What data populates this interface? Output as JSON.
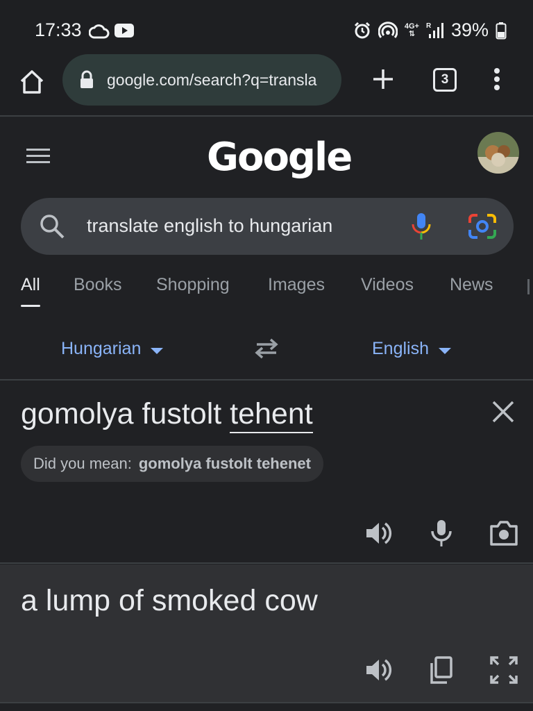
{
  "status_bar": {
    "time": "17:33",
    "network_top": "4G+",
    "network_roaming": "R",
    "battery_percent": "39%"
  },
  "browser": {
    "url": "google.com/search?q=transla",
    "tab_count": "3"
  },
  "google": {
    "logo_text": "Google"
  },
  "search": {
    "query": "translate english to hungarian"
  },
  "tabs": [
    {
      "label": "All",
      "active": true
    },
    {
      "label": "Books"
    },
    {
      "label": "Shopping"
    },
    {
      "label": "Images"
    },
    {
      "label": "Videos"
    },
    {
      "label": "News"
    }
  ],
  "translator": {
    "source_language": "Hungarian",
    "target_language": "English",
    "source_text_part1": "gomolya fustolt ",
    "source_text_part2": "tehent",
    "did_you_mean_label": "Did you mean:",
    "did_you_mean_suggestion": "gomolya fustolt tehenet",
    "translation": "a lump of smoked cow"
  },
  "colors": {
    "background": "#202124",
    "accent_link": "#8ab4f8",
    "result_panel": "#303134"
  }
}
